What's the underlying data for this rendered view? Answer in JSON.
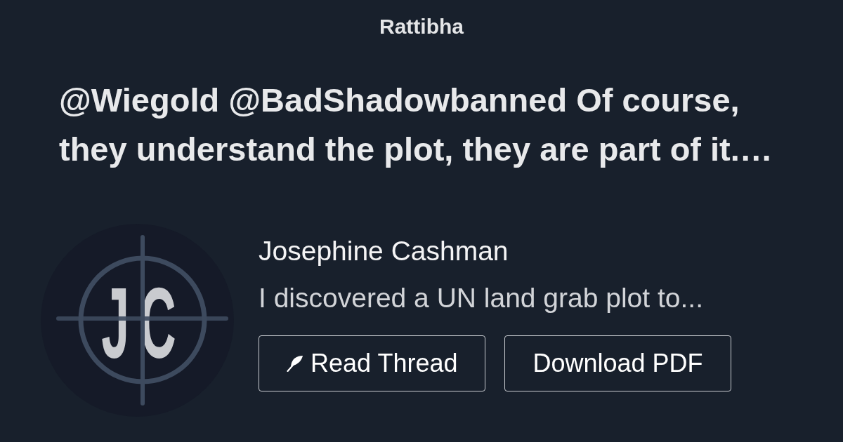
{
  "site": {
    "name": "Rattibha"
  },
  "thread": {
    "title": "@Wiegold @BadShadowbanned Of course, they understand the plot, they are part of it.…"
  },
  "author": {
    "avatar_monogram": "JC",
    "name": "Josephine Cashman",
    "bio": "I discovered a UN land grab plot to..."
  },
  "buttons": [
    {
      "label": "Read Thread",
      "kind": "thread"
    },
    {
      "label": "Download PDF",
      "kind": "pdf"
    }
  ]
}
